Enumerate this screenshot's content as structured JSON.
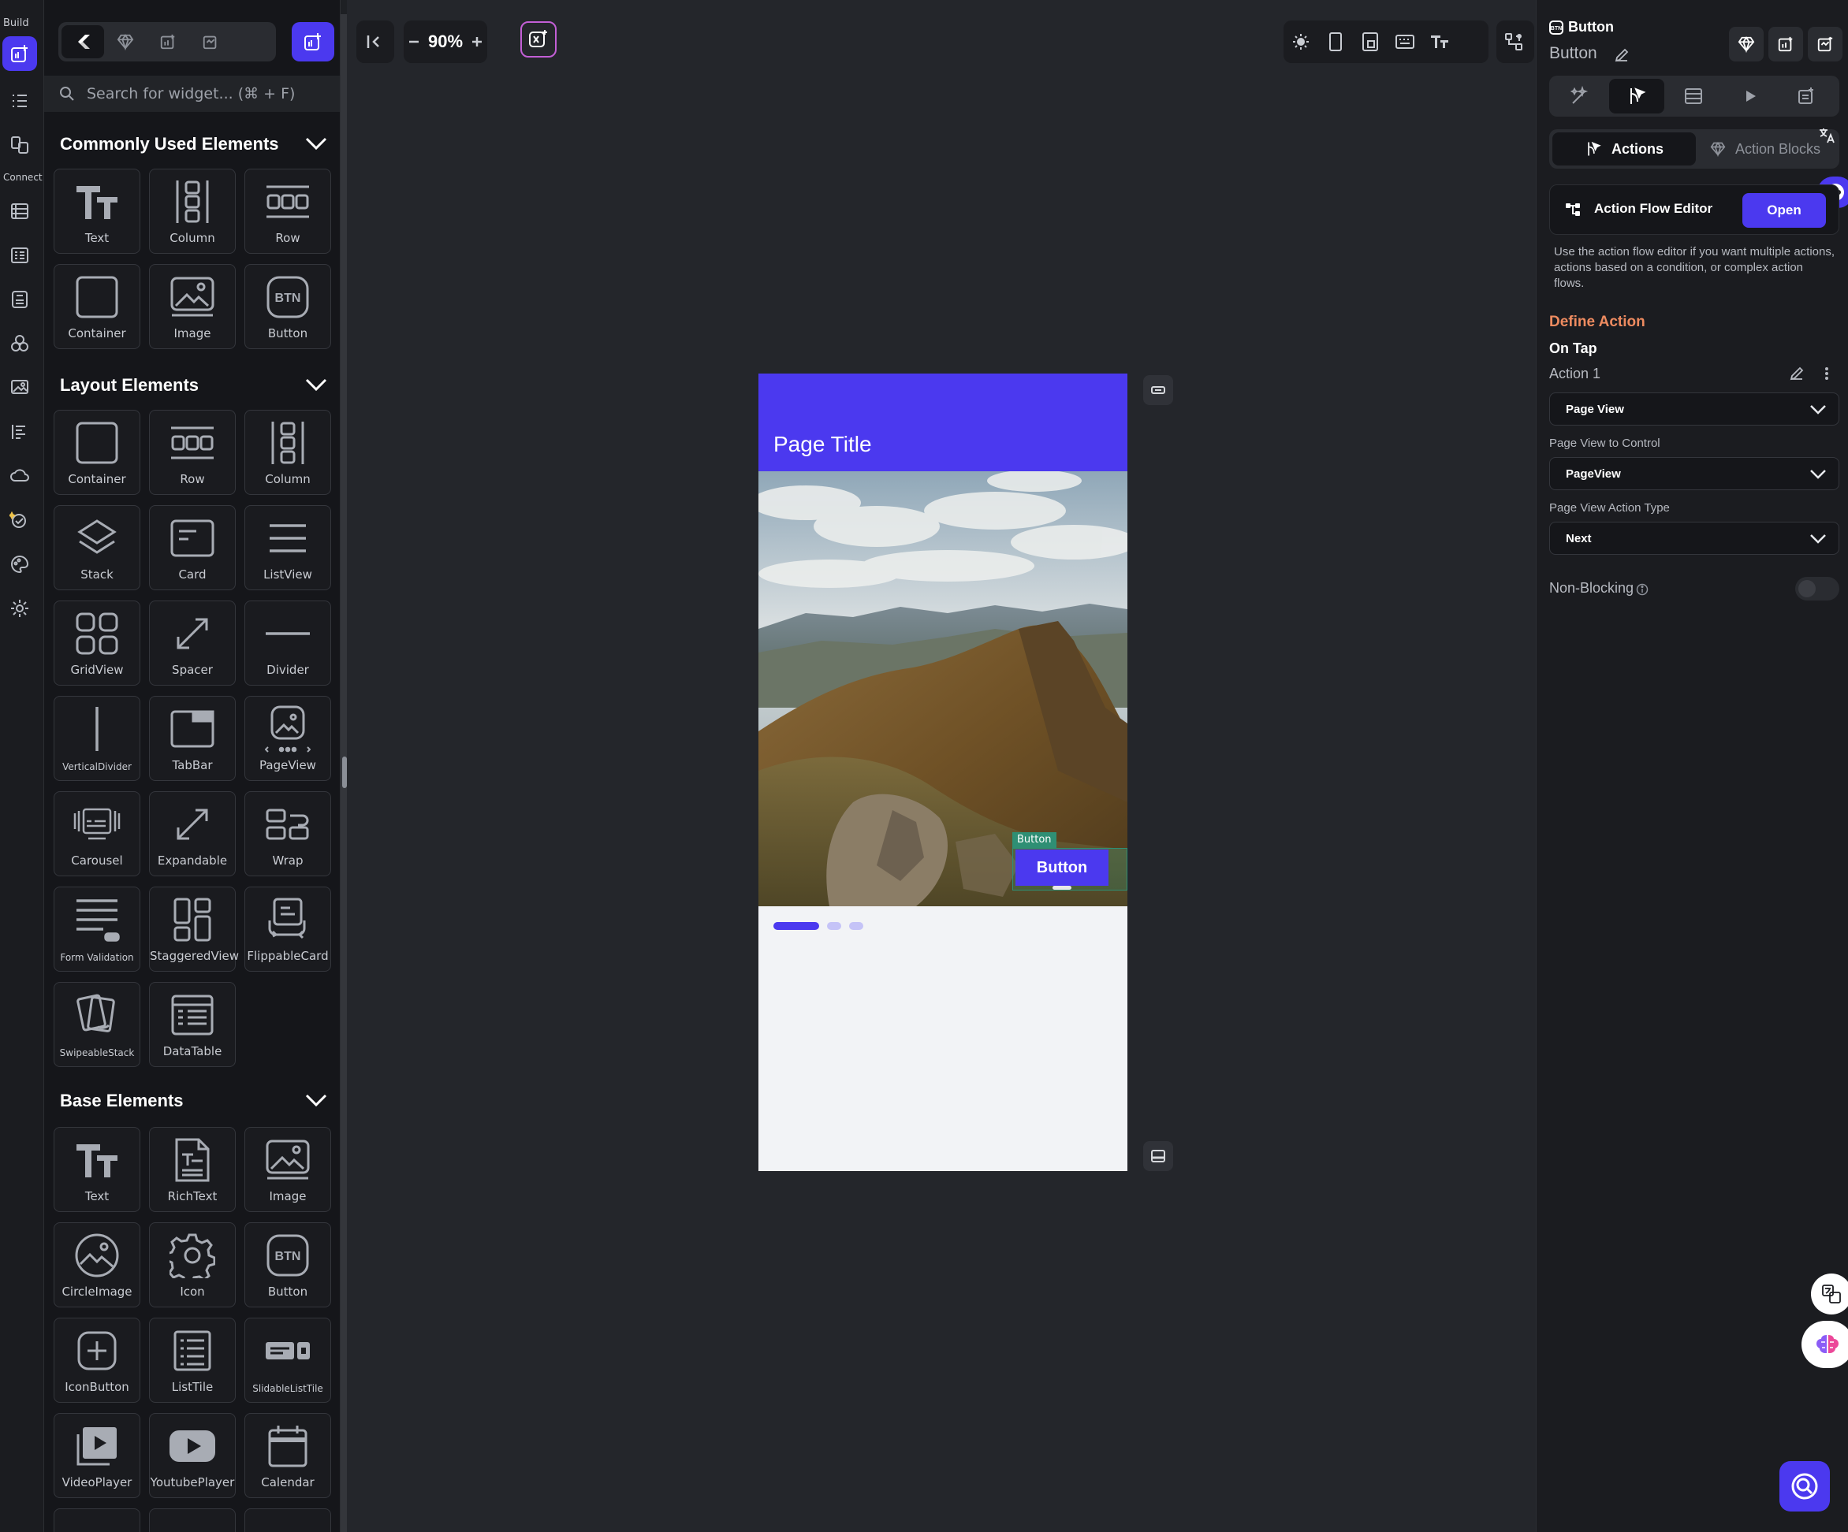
{
  "rail": {
    "build_label": "Build",
    "connect_label": "Connect"
  },
  "panel": {
    "search_placeholder": "Search for widget... (⌘ + F)",
    "sections": [
      {
        "title": "Commonly Used Elements",
        "items": [
          "Text",
          "Column",
          "Row",
          "Container",
          "Image",
          "Button"
        ]
      },
      {
        "title": "Layout Elements",
        "items": [
          "Container",
          "Row",
          "Column",
          "Stack",
          "Card",
          "ListView",
          "GridView",
          "Spacer",
          "Divider",
          "VerticalDivider",
          "TabBar",
          "PageView",
          "Carousel",
          "Expandable",
          "Wrap",
          "Form Validation",
          "StaggeredView",
          "FlippableCard",
          "SwipeableStack",
          "DataTable"
        ]
      },
      {
        "title": "Base Elements",
        "items": [
          "Text",
          "RichText",
          "Image",
          "CircleImage",
          "Icon",
          "Button",
          "IconButton",
          "ListTile",
          "SlidableListTile",
          "VideoPlayer",
          "YoutubePlayer",
          "Calendar"
        ]
      }
    ]
  },
  "toolbar": {
    "zoom": "90%"
  },
  "phone": {
    "page_title": "Page Title",
    "selection_tag": "Button",
    "button_label": "Button",
    "page_indicator": {
      "count": 3,
      "active": 0
    }
  },
  "props": {
    "widget_type": "Button",
    "widget_name": "Button",
    "subtab_actions": "Actions",
    "subtab_blocks": "Action Blocks",
    "flow_editor_title": "Action Flow Editor",
    "open_label": "Open",
    "flow_help": "Use the action flow editor if you want multiple actions, actions based on a condition, or complex action flows.",
    "define_action": "Define Action",
    "on_tap": "On Tap",
    "action_1": "Action 1",
    "action_type": "Page View",
    "page_view_to_control_label": "Page View to Control",
    "page_view_to_control_value": "PageView",
    "page_view_action_type_label": "Page View Action Type",
    "page_view_action_type_value": "Next",
    "non_blocking_label": "Non-Blocking",
    "non_blocking_on": false
  },
  "colors": {
    "accent": "#4b39ef",
    "define_action": "#ee8b60",
    "selection": "#2f8f74"
  }
}
